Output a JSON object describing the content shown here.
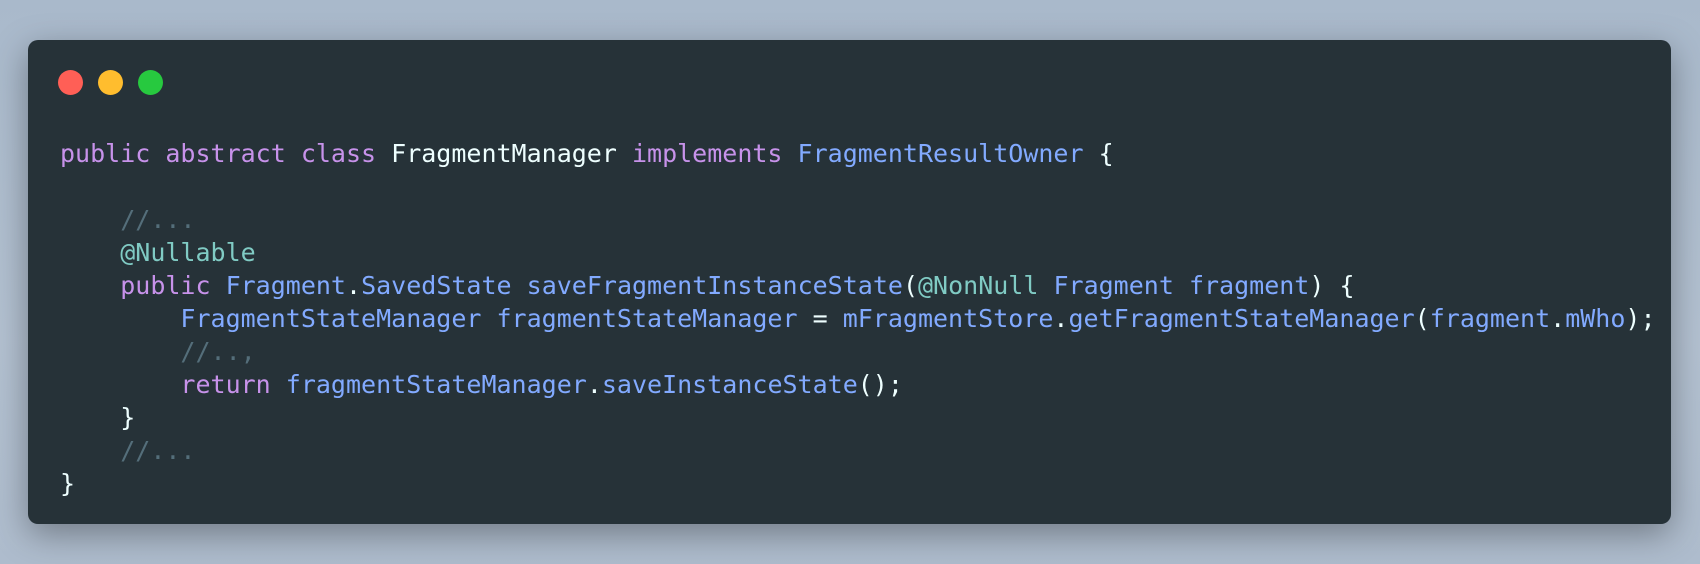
{
  "window": {
    "controls": {
      "close": {
        "icon": "close-dot-icon",
        "color": "#ff5f56"
      },
      "minimize": {
        "icon": "minimize-dot-icon",
        "color": "#ffbd2e"
      },
      "zoom": {
        "icon": "zoom-dot-icon",
        "color": "#27c93f"
      }
    }
  },
  "code": {
    "language": "java",
    "lines": [
      [
        {
          "text": "public ",
          "cls": "k"
        },
        {
          "text": "abstract ",
          "cls": "k"
        },
        {
          "text": "class ",
          "cls": "k"
        },
        {
          "text": "FragmentManager ",
          "cls": "p"
        },
        {
          "text": "implements ",
          "cls": "k"
        },
        {
          "text": "FragmentResultOwner",
          "cls": "ty"
        },
        {
          "text": " {",
          "cls": "p"
        }
      ],
      [],
      [
        {
          "text": "    ",
          "cls": "p"
        },
        {
          "text": "//...",
          "cls": "c"
        }
      ],
      [
        {
          "text": "    ",
          "cls": "p"
        },
        {
          "text": "@Nullable",
          "cls": "an"
        }
      ],
      [
        {
          "text": "    ",
          "cls": "p"
        },
        {
          "text": "public ",
          "cls": "k"
        },
        {
          "text": "Fragment",
          "cls": "ty"
        },
        {
          "text": ".",
          "cls": "p"
        },
        {
          "text": "SavedState ",
          "cls": "ty"
        },
        {
          "text": "saveFragmentInstanceState",
          "cls": "f"
        },
        {
          "text": "(",
          "cls": "p"
        },
        {
          "text": "@NonNull ",
          "cls": "an"
        },
        {
          "text": "Fragment ",
          "cls": "ty"
        },
        {
          "text": "fragment",
          "cls": "f"
        },
        {
          "text": ") {",
          "cls": "p"
        }
      ],
      [
        {
          "text": "        ",
          "cls": "p"
        },
        {
          "text": "FragmentStateManager ",
          "cls": "ty"
        },
        {
          "text": "fragmentStateManager",
          "cls": "f"
        },
        {
          "text": " = ",
          "cls": "p"
        },
        {
          "text": "mFragmentStore",
          "cls": "f"
        },
        {
          "text": ".",
          "cls": "p"
        },
        {
          "text": "getFragmentStateManager",
          "cls": "f"
        },
        {
          "text": "(",
          "cls": "p"
        },
        {
          "text": "fragment",
          "cls": "f"
        },
        {
          "text": ".",
          "cls": "p"
        },
        {
          "text": "mWho",
          "cls": "f"
        },
        {
          "text": ");",
          "cls": "p"
        }
      ],
      [
        {
          "text": "        ",
          "cls": "p"
        },
        {
          "text": "//..,",
          "cls": "c"
        }
      ],
      [
        {
          "text": "        ",
          "cls": "p"
        },
        {
          "text": "return ",
          "cls": "k"
        },
        {
          "text": "fragmentStateManager",
          "cls": "f"
        },
        {
          "text": ".",
          "cls": "p"
        },
        {
          "text": "saveInstanceState",
          "cls": "f"
        },
        {
          "text": "();",
          "cls": "p"
        }
      ],
      [
        {
          "text": "    }",
          "cls": "p"
        }
      ],
      [
        {
          "text": "    ",
          "cls": "p"
        },
        {
          "text": "//...",
          "cls": "c"
        }
      ],
      [
        {
          "text": "}",
          "cls": "p"
        }
      ]
    ]
  }
}
